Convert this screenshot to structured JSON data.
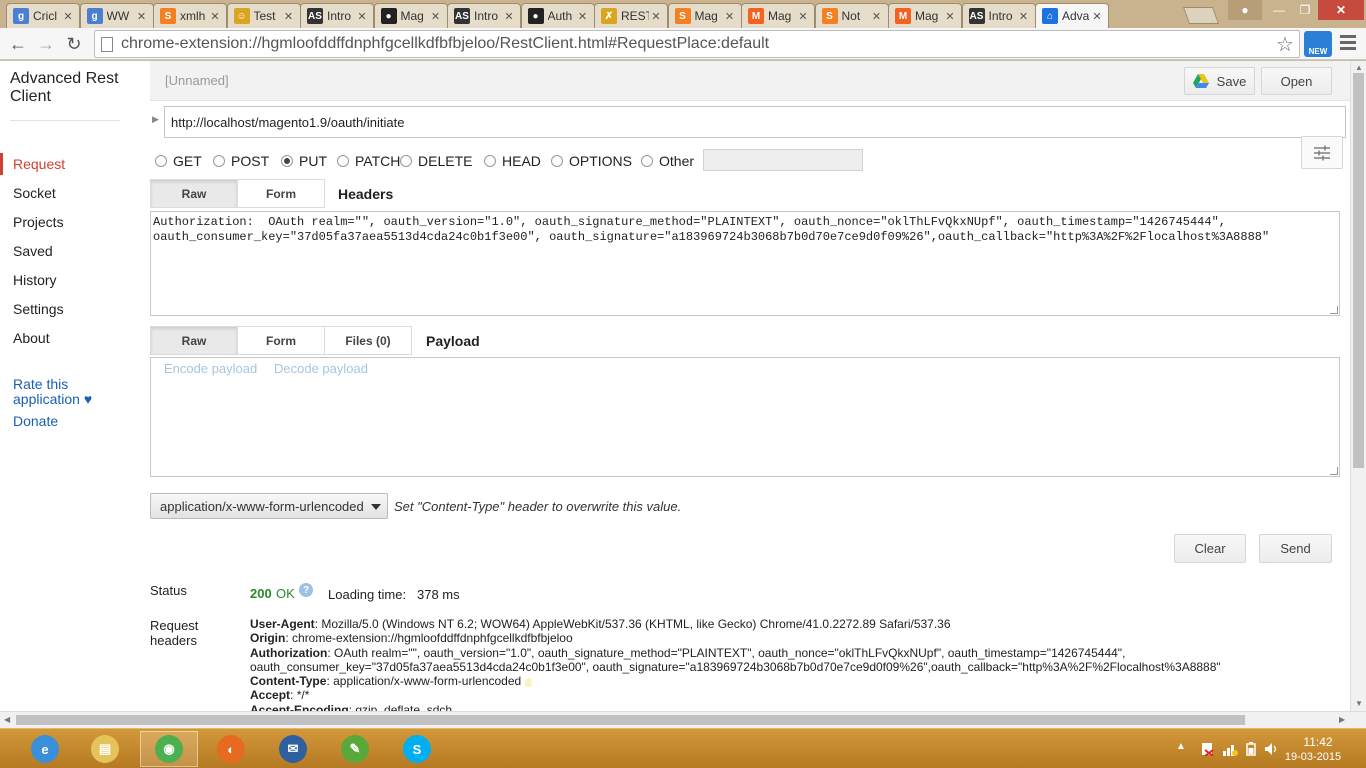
{
  "browser": {
    "tabs": [
      {
        "label": "Cricl",
        "icon": "google-icon",
        "color": "#4a7fd4",
        "glyph": "g"
      },
      {
        "label": "WW",
        "icon": "google-icon",
        "color": "#4a7fd4",
        "glyph": "g"
      },
      {
        "label": "xmlh",
        "icon": "stackoverflow-icon",
        "color": "#f48024",
        "glyph": "S"
      },
      {
        "label": "Test",
        "icon": "smiley-icon",
        "color": "#d9a520",
        "glyph": "☺"
      },
      {
        "label": "Intro",
        "icon": "as-icon",
        "color": "#333333",
        "glyph": "AS"
      },
      {
        "label": "Mag",
        "icon": "github-icon",
        "color": "#222222",
        "glyph": "●"
      },
      {
        "label": "Intro",
        "icon": "as-icon",
        "color": "#333333",
        "glyph": "AS"
      },
      {
        "label": "Auth",
        "icon": "github-icon",
        "color": "#222222",
        "glyph": "●"
      },
      {
        "label": "REST",
        "icon": "x-icon",
        "color": "#d9a520",
        "glyph": "✗"
      },
      {
        "label": "Mag",
        "icon": "stackoverflow-icon",
        "color": "#f48024",
        "glyph": "S"
      },
      {
        "label": "Mag",
        "icon": "magento-icon",
        "color": "#f26322",
        "glyph": "M"
      },
      {
        "label": "Not",
        "icon": "stackoverflow-icon",
        "color": "#f48024",
        "glyph": "S"
      },
      {
        "label": "Mag",
        "icon": "magento-icon",
        "color": "#f26322",
        "glyph": "M"
      },
      {
        "label": "Intro",
        "icon": "as-icon",
        "color": "#333333",
        "glyph": "AS"
      },
      {
        "label": "Adva",
        "icon": "home-icon",
        "color": "#1e73e0",
        "glyph": "⌂",
        "active": true
      }
    ],
    "url": "chrome-extension://hgmloofddffdnphfgcellkdfbfbjeloo/RestClient.html#RequestPlace:default",
    "ext_badge": "NEW"
  },
  "sidebar": {
    "title": "Advanced Rest Client",
    "items": [
      "Request",
      "Socket",
      "Projects",
      "Saved",
      "History",
      "Settings",
      "About"
    ],
    "rate": "Rate this application ♥",
    "donate": "Donate"
  },
  "topbar": {
    "project": "[Unnamed]",
    "save": "Save",
    "open": "Open"
  },
  "request": {
    "url": "http://localhost/magento1.9/oauth/initiate",
    "methods": [
      "GET",
      "POST",
      "PUT",
      "PATCH",
      "DELETE",
      "HEAD",
      "OPTIONS",
      "Other"
    ],
    "selected_method": "PUT"
  },
  "headers_section": {
    "tabs": [
      "Raw",
      "Form"
    ],
    "title": "Headers",
    "raw": "Authorization:  OAuth realm=\"\", oauth_version=\"1.0\", oauth_signature_method=\"PLAINTEXT\", oauth_nonce=\"oklThLFvQkxNUpf\", oauth_timestamp=\"1426745444\",\noauth_consumer_key=\"37d05fa37aea5513d4cda24c0b1f3e00\", oauth_signature=\"a183969724b3068b7b0d70e7ce9d0f09%26\",oauth_callback=\"http%3A%2F%2Flocalhost%3A8888\""
  },
  "payload_section": {
    "tabs": [
      "Raw",
      "Form",
      "Files (0)"
    ],
    "title": "Payload",
    "encode": "Encode payload",
    "decode": "Decode payload"
  },
  "content_type": {
    "value": "application/x-www-form-urlencoded",
    "hint": "Set \"Content-Type\" header to overwrite this value."
  },
  "actions": {
    "clear": "Clear",
    "send": "Send"
  },
  "response": {
    "status_label": "Status",
    "status_code": "200",
    "status_text": "OK",
    "loading_label": "Loading time:",
    "loading_value": "378 ms",
    "req_headers_label": "Request headers",
    "headers": [
      {
        "name": "User-Agent",
        "value": "Mozilla/5.0 (Windows NT 6.2; WOW64) AppleWebKit/537.36 (KHTML, like Gecko) Chrome/41.0.2272.89 Safari/537.36"
      },
      {
        "name": "Origin",
        "value": "chrome-extension://hgmloofddffdnphfgcellkdfbfbjeloo"
      },
      {
        "name": "Authorization",
        "value": "OAuth realm=\"\", oauth_version=\"1.0\", oauth_signature_method=\"PLAINTEXT\", oauth_nonce=\"oklThLFvQkxNUpf\", oauth_timestamp=\"1426745444\",",
        "cont": "oauth_consumer_key=\"37d05fa37aea5513d4cda24c0b1f3e00\", oauth_signature=\"a183969724b3068b7b0d70e7ce9d0f09%26\",oauth_callback=\"http%3A%2F%2Flocalhost%3A8888\""
      },
      {
        "name": "Content-Type",
        "value": "application/x-www-form-urlencoded"
      },
      {
        "name": "Accept",
        "value": "*/*"
      },
      {
        "name": "Accept-Encoding",
        "value": "gzip, deflate, sdch"
      }
    ]
  },
  "taskbar": {
    "apps": [
      {
        "icon": "ie-icon",
        "color": "#3b8fd9",
        "glyph": "e"
      },
      {
        "icon": "file-explorer-icon",
        "color": "#e6c35a",
        "glyph": "▤"
      },
      {
        "icon": "chrome-icon",
        "color": "#4caf50",
        "glyph": "◉",
        "open": true
      },
      {
        "icon": "firefox-icon",
        "color": "#e66a1f",
        "glyph": "◐"
      },
      {
        "icon": "thunderbird-icon",
        "color": "#2e5f9e",
        "glyph": "✉"
      },
      {
        "icon": "notepad-icon",
        "color": "#5aa83c",
        "glyph": "✎"
      },
      {
        "icon": "skype-icon",
        "color": "#00aff0",
        "glyph": "S"
      }
    ],
    "time": "11:42",
    "date": "19-03-2015"
  }
}
